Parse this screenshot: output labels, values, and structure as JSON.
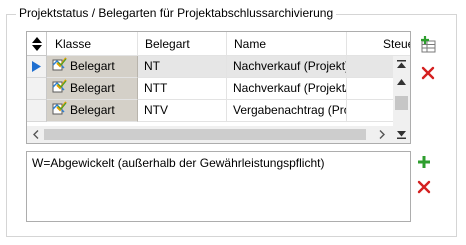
{
  "group": {
    "title": "Projektstatus / Belegarten für Projektabschlussarchivierung"
  },
  "grid": {
    "columns": [
      "Klasse",
      "Belegart",
      "Name",
      "Steue"
    ],
    "rows": [
      {
        "klasse": "Belegart",
        "belegart": "NT",
        "name": "Nachverkauf (Projekt)",
        "selected": true
      },
      {
        "klasse": "Belegart",
        "belegart": "NTT",
        "name": "Nachverkauf (Projekt/",
        "selected": false
      },
      {
        "klasse": "Belegart",
        "belegart": "NTV",
        "name": "Vergabenachtrag (Pro",
        "selected": false
      }
    ]
  },
  "memo": {
    "text": "W=Abgewickelt (außerhalb der Gewährleistungspflicht)"
  },
  "icons": {
    "sort": "sort-updown-icon",
    "row_pointer": "row-pointer-icon",
    "klasse": "document-check-icon",
    "add_grid": "add-table-row-icon",
    "delete_grid": "delete-icon",
    "add_memo": "add-icon",
    "delete_memo": "delete-icon"
  },
  "colors": {
    "pointer": "#1f6fd0",
    "add": "#2e9e2e",
    "delete": "#d42020",
    "klasse_bg": "#d4d0c8",
    "selected_bg": "#e6e6e6"
  }
}
